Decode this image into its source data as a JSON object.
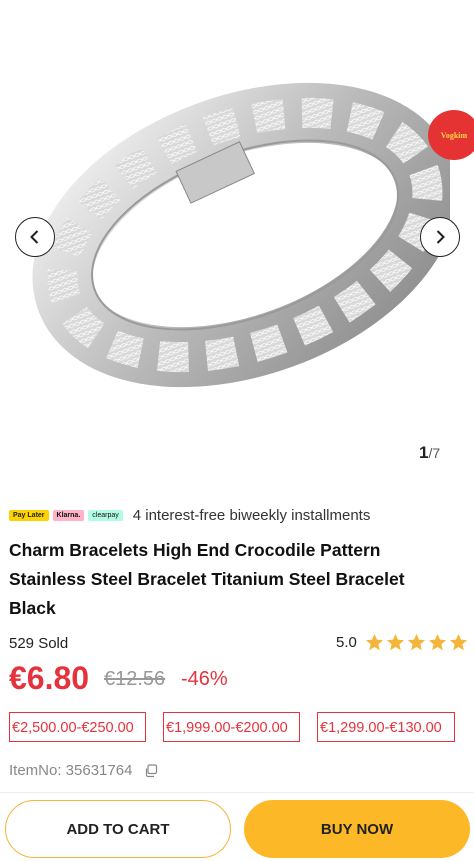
{
  "gallery": {
    "image_alt": "Silver crocodile pattern steel bracelet",
    "counter_current": "1",
    "counter_total": "/7",
    "badge_text": "Vogkim"
  },
  "payment": {
    "logos": [
      "Pay Later",
      "Klarna.",
      "clearpay"
    ],
    "text": "4 interest-free biweekly installments"
  },
  "product": {
    "title": "Charm Bracelets High End Crocodile Pattern Stainless Steel Bracelet Titanium Steel Bracelet Black",
    "sold": "529 Sold",
    "rating": "5.0",
    "stars": 5,
    "price": "€6.80",
    "original_price": "€12.56",
    "discount": "-46%",
    "coupons": [
      "€2,500.00-€250.00",
      "€1,999.00-€200.00",
      "€1,299.00-€130.00"
    ],
    "item_no": "ItemNo: 35631764"
  },
  "actions": {
    "add_to_cart": "ADD TO CART",
    "buy_now": "BUY NOW"
  },
  "colors": {
    "accent_red": "#e5333e",
    "button_yellow": "#fdb827",
    "star": "#f4b63a"
  }
}
